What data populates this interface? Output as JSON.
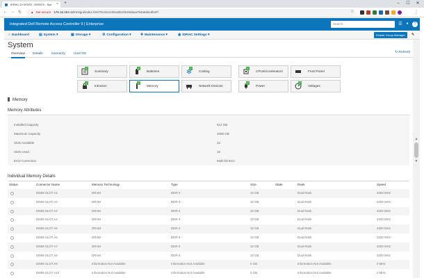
{
  "browser": {
    "tab_title": "iDRAC-DYJK9S3 - iDRAC9 - Sys",
    "close_glyph": "×",
    "new_tab_glyph": "+",
    "win_minimize": "–",
    "win_maximize": "☐",
    "win_close": "✕",
    "back_glyph": "←",
    "forward_glyph": "→",
    "reload_glyph": "↻",
    "warning_glyph": "▲",
    "not_secure": "Not secure",
    "url_host": "176.16.254.12",
    "url_path": "/restgui/index.html?0c3114491a6b10515daea784a6dacdb4#/",
    "star_glyph": "☆",
    "menu_glyph": "⋮"
  },
  "header": {
    "title": "Integrated Dell Remote Access Controller 9 | Enterprise",
    "search_placeholder": "Search",
    "icon_jobs": "☰",
    "icon_user": "👤",
    "icon_help": "?"
  },
  "menu": {
    "dashboard": "Dashboard",
    "system": "System",
    "storage": "Storage",
    "configuration": "Configuration",
    "maintenance": "Maintenance",
    "idrac_settings": "iDRAC Settings",
    "group_manager": "Enable Group Manager",
    "pin_glyph": "✎",
    "caret": "▾"
  },
  "page": {
    "title": "System",
    "tabs": [
      "Overview",
      "Details",
      "Inventory",
      "Host OS"
    ],
    "refresh": "Refresh",
    "refresh_glyph": "↻"
  },
  "tiles": [
    {
      "label": "Summary",
      "icon": "summary-icon",
      "selected": false
    },
    {
      "label": "Batteries",
      "icon": "battery-icon",
      "selected": false
    },
    {
      "label": "Cooling",
      "icon": "fan-icon",
      "selected": false
    },
    {
      "label": "CPUs/Accelerators",
      "icon": "cpu-icon",
      "selected": false
    },
    {
      "label": "Front Panel",
      "icon": "front-panel-icon",
      "selected": false
    },
    {
      "label": "Intrusion",
      "icon": "lock-icon",
      "selected": false
    },
    {
      "label": "Memory",
      "icon": "memory-icon",
      "selected": true
    },
    {
      "label": "Network Devices",
      "icon": "network-icon",
      "selected": false
    },
    {
      "label": "Power",
      "icon": "power-plug-icon",
      "selected": false
    },
    {
      "label": "Voltages",
      "icon": "voltage-gauge-icon",
      "selected": false
    }
  ],
  "memory": {
    "heading": "Memory",
    "attributes_title": "Memory Attributes",
    "attributes": [
      {
        "label": "Installed Capacity",
        "value": "512 GB"
      },
      {
        "label": "Maximum Capacity",
        "value": "4096 GB"
      },
      {
        "label": "Slots Available",
        "value": "32"
      },
      {
        "label": "Slots Used",
        "value": "16"
      },
      {
        "label": "Error Correction",
        "value": "Multi-bit ECC"
      }
    ],
    "details_title": "Individual Memory Details",
    "columns": [
      "Status",
      "Connector Name",
      "Memory Technology",
      "Type",
      "Size",
      "State",
      "Rank",
      "Speed"
    ],
    "rows": [
      {
        "name": "DIMM SLOT A1",
        "tech": "DRAM",
        "type": "DDR-4",
        "size": "32 GB",
        "rank": "Dual Rank",
        "speed": "3200 MHz"
      },
      {
        "name": "DIMM SLOT A2",
        "tech": "DRAM",
        "type": "DDR-4",
        "size": "32 GB",
        "rank": "Dual Rank",
        "speed": "3200 MHz"
      },
      {
        "name": "DIMM SLOT A3",
        "tech": "DRAM",
        "type": "DDR-4",
        "size": "32 GB",
        "rank": "Dual Rank",
        "speed": "3200 MHz"
      },
      {
        "name": "DIMM SLOT A4",
        "tech": "DRAM",
        "type": "DDR-4",
        "size": "32 GB",
        "rank": "Dual Rank",
        "speed": "3200 MHz"
      },
      {
        "name": "DIMM SLOT A5",
        "tech": "DRAM",
        "type": "DDR-4",
        "size": "32 GB",
        "rank": "Dual Rank",
        "speed": "3200 MHz"
      },
      {
        "name": "DIMM SLOT A6",
        "tech": "DRAM",
        "type": "DDR-4",
        "size": "32 GB",
        "rank": "Dual Rank",
        "speed": "3200 MHz"
      },
      {
        "name": "DIMM SLOT A7",
        "tech": "DRAM",
        "type": "DDR-4",
        "size": "32 GB",
        "rank": "Dual Rank",
        "speed": "3200 MHz"
      },
      {
        "name": "DIMM SLOT A8",
        "tech": "DRAM",
        "type": "DDR-4",
        "size": "32 GB",
        "rank": "Dual Rank",
        "speed": "3200 MHz"
      },
      {
        "name": "DIMM SLOT A9",
        "tech": "Information Not Available",
        "type": "Information Not Available",
        "size": "0 GB",
        "rank": "Information Not Available",
        "speed": "0 MHz"
      },
      {
        "name": "DIMM SLOT A10",
        "tech": "Information Not Available",
        "type": "Information Not Available",
        "size": "0 GB",
        "rank": "Information Not Available",
        "speed": "0 MHz"
      }
    ]
  },
  "colors": {
    "brand": "#0d75b9",
    "ok": "#4caf50"
  }
}
